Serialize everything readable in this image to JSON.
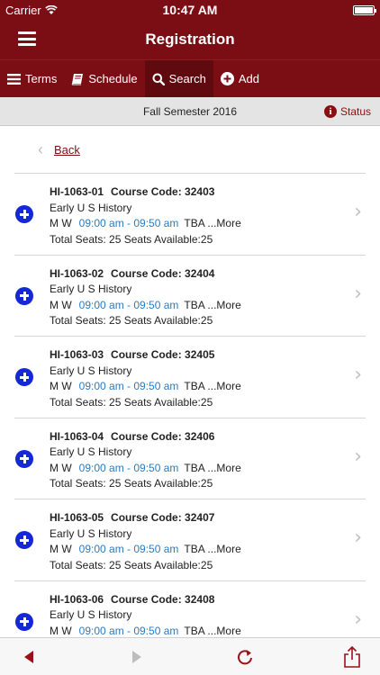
{
  "status_bar": {
    "carrier": "Carrier",
    "time": "10:47 AM"
  },
  "nav": {
    "title": "Registration"
  },
  "tabs": [
    {
      "label": "Terms",
      "icon": "list-icon"
    },
    {
      "label": "Schedule",
      "icon": "book-icon"
    },
    {
      "label": "Search",
      "icon": "search-icon",
      "active": true
    },
    {
      "label": "Add",
      "icon": "plus-circle-icon"
    }
  ],
  "term_bar": {
    "term": "Fall Semester 2016",
    "status_label": "Status"
  },
  "back_label": "Back",
  "courses": [
    {
      "section": "HI-1063-01",
      "code_label": "Course Code: 32403",
      "title": "Early U S History",
      "days": "M W",
      "time": "09:00 am - 09:50 am",
      "room": "TBA ...More",
      "seats": "Total Seats: 25  Seats Available:25"
    },
    {
      "section": "HI-1063-02",
      "code_label": "Course Code: 32404",
      "title": "Early U S History",
      "days": "M W",
      "time": "09:00 am - 09:50 am",
      "room": "TBA ...More",
      "seats": "Total Seats: 25  Seats Available:25"
    },
    {
      "section": "HI-1063-03",
      "code_label": "Course Code: 32405",
      "title": "Early U S History",
      "days": "M W",
      "time": "09:00 am - 09:50 am",
      "room": "TBA ...More",
      "seats": "Total Seats: 25  Seats Available:25"
    },
    {
      "section": "HI-1063-04",
      "code_label": "Course Code: 32406",
      "title": "Early U S History",
      "days": "M W",
      "time": "09:00 am - 09:50 am",
      "room": "TBA ...More",
      "seats": "Total Seats: 25  Seats Available:25"
    },
    {
      "section": "HI-1063-05",
      "code_label": "Course Code: 32407",
      "title": "Early U S History",
      "days": "M W",
      "time": "09:00 am - 09:50 am",
      "room": "TBA ...More",
      "seats": "Total Seats: 25  Seats Available:25"
    },
    {
      "section": "HI-1063-06",
      "code_label": "Course Code: 32408",
      "title": "Early U S History",
      "days": "M W",
      "time": "09:00 am - 09:50 am",
      "room": "TBA ...More",
      "seats": ""
    }
  ],
  "toolbar": {
    "icons": [
      "back-arrow-icon",
      "forward-arrow-icon",
      "refresh-icon",
      "share-icon"
    ]
  },
  "colors": {
    "brand": "#7a0e14",
    "add_icon": "#1428d6",
    "time_text": "#2a7bbf"
  }
}
